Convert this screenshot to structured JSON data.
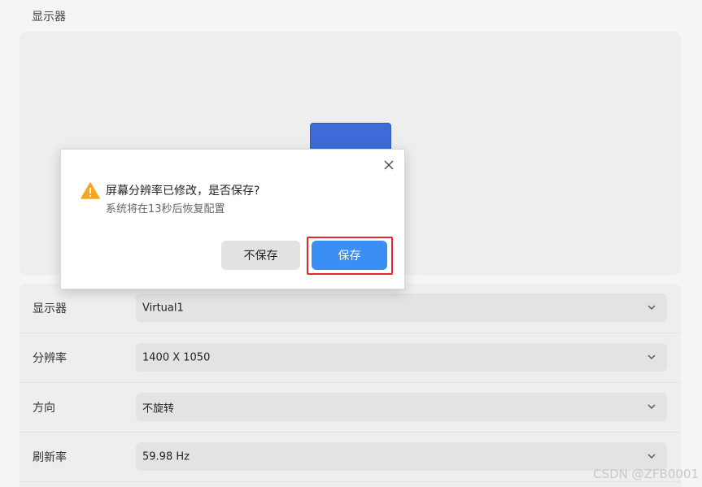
{
  "section_title": "显示器",
  "dialog": {
    "title": "屏幕分辨率已修改，是否保存?",
    "message": "系统将在13秒后恢复配置",
    "cancel_label": "不保存",
    "save_label": "保存",
    "warning_color": "#f5a623",
    "save_color": "#3b8ff4",
    "highlight_color": "#e5262a"
  },
  "settings": [
    {
      "label": "显示器",
      "value": "Virtual1"
    },
    {
      "label": "分辨率",
      "value": "1400 X 1050"
    },
    {
      "label": "方向",
      "value": "不旋转"
    },
    {
      "label": "刷新率",
      "value": "59.98 Hz"
    }
  ],
  "watermark": "CSDN @ZFB0001",
  "monitor_color": "#3d6bd8"
}
